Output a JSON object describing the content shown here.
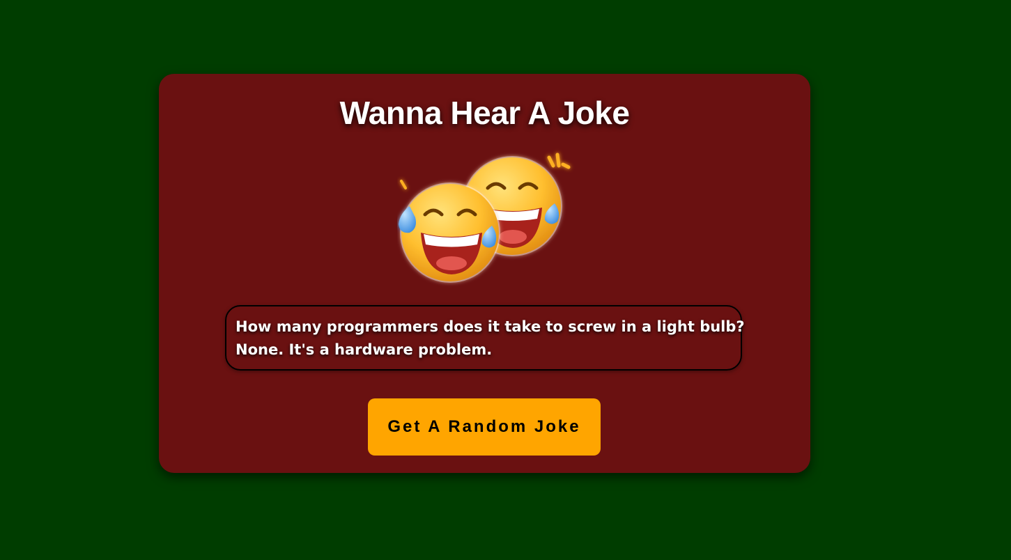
{
  "page": {
    "background_color": "#003d00"
  },
  "card": {
    "title": "Wanna Hear A Joke",
    "background_color": "#6a1111",
    "image": {
      "icon": "laughing-emojis-icon",
      "alt": "two crying-laughing emoji faces"
    },
    "joke": {
      "setup": "How many programmers does it take to screw in a light bulb?",
      "punchline": "None. It's a hardware problem."
    },
    "button": {
      "label": "Get A Random Joke",
      "color": "#ffa500"
    }
  }
}
